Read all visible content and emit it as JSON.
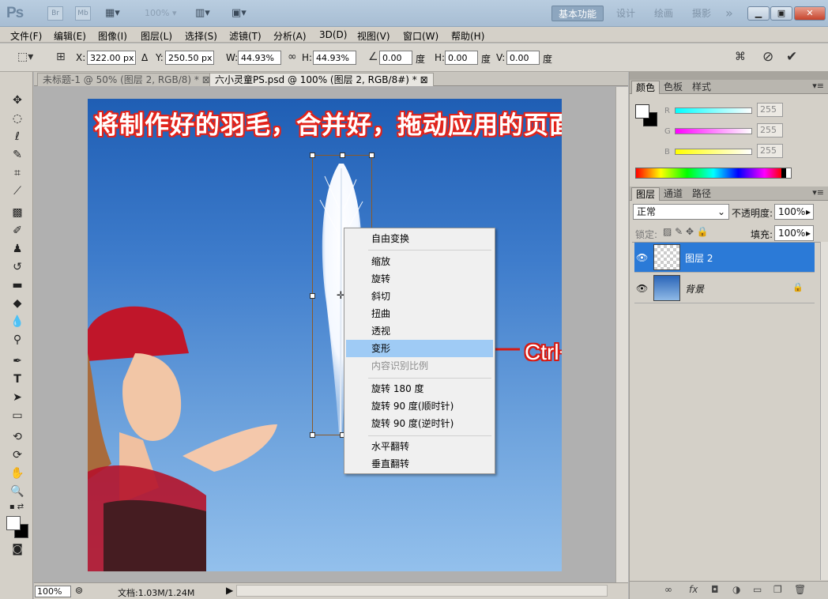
{
  "titlebar": {
    "logo": "Ps",
    "br": "Br",
    "mb": "Mb",
    "zoom": "100%",
    "workspaces": [
      "基本功能",
      "设计",
      "绘画",
      "摄影"
    ],
    "more": "»"
  },
  "menu": [
    "文件(F)",
    "编辑(E)",
    "图像(I)",
    "图层(L)",
    "选择(S)",
    "滤镜(T)",
    "分析(A)",
    "3D(D)",
    "视图(V)",
    "窗口(W)",
    "帮助(H)"
  ],
  "options": {
    "x_label": "X:",
    "x": "322.00 px",
    "delta": "Δ",
    "y_label": "Y:",
    "y": "250.50 px",
    "w_label": "W:",
    "w": "44.93%",
    "h_label": "H:",
    "h": "44.93%",
    "angle": "0.00",
    "angle_unit": "度",
    "hskew_label": "H:",
    "hskew": "0.00",
    "hskew_unit": "度",
    "vskew_label": "V:",
    "vskew": "0.00",
    "vskew_unit": "度"
  },
  "tabs": [
    {
      "label": "未标题-1 @ 50% (图层 2, RGB/8) *"
    },
    {
      "label": "六小灵童PS.psd @ 100% (图层 2, RGB/8#) *"
    }
  ],
  "canvas": {
    "headline": "将制作好的羽毛，合并好，拖动应用的页面",
    "annotation": "Ctrl+T变换，变形扭曲"
  },
  "context_menu": {
    "items": [
      {
        "label": "自由变换",
        "state": "normal"
      },
      {
        "label": "缩放",
        "state": "normal"
      },
      {
        "label": "旋转",
        "state": "normal"
      },
      {
        "label": "斜切",
        "state": "normal"
      },
      {
        "label": "扭曲",
        "state": "normal"
      },
      {
        "label": "透视",
        "state": "normal"
      },
      {
        "label": "变形",
        "state": "highlighted"
      },
      {
        "label": "内容识别比例",
        "state": "disabled"
      },
      {
        "label": "旋转 180 度",
        "state": "normal"
      },
      {
        "label": "旋转 90 度(顺时针)",
        "state": "normal"
      },
      {
        "label": "旋转 90 度(逆时针)",
        "state": "normal"
      },
      {
        "label": "水平翻转",
        "state": "normal"
      },
      {
        "label": "垂直翻转",
        "state": "normal"
      }
    ]
  },
  "status": {
    "zoom": "100%",
    "docinfo": "文档:1.03M/1.24M"
  },
  "color_panel": {
    "tabs": [
      "颜色",
      "色板",
      "样式"
    ],
    "r_label": "R",
    "r": "255",
    "g_label": "G",
    "g": "255",
    "b_label": "B",
    "b": "255"
  },
  "layers_panel": {
    "tabs": [
      "图层",
      "通道",
      "路径"
    ],
    "blend_mode": "正常",
    "opacity_label": "不透明度:",
    "opacity": "100%",
    "lock_label": "锁定:",
    "fill_label": "填充:",
    "fill": "100%",
    "layers": [
      {
        "name": "图层 2",
        "selected": true
      },
      {
        "name": "背景",
        "selected": false
      }
    ]
  },
  "colors": {
    "selection": "#2b7ad7",
    "menu_highlight": "#9fcbf5",
    "annotation_red": "#d71b14"
  }
}
